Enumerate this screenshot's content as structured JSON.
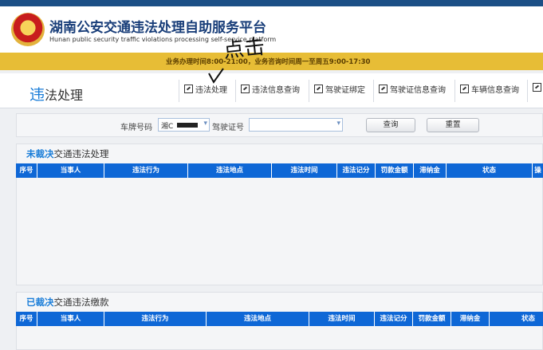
{
  "header": {
    "title_cn": "湖南公安交通违法处理自助服务平台",
    "title_en": "Hunan public security traffic violations processing self-service platform"
  },
  "notice": "业务办理时间8:00-21:00，业务咨询时间周一至周五9:00-17:30",
  "page_title_highlight": "违",
  "page_title_rest": "法处理",
  "nav": [
    {
      "label": "违法处理",
      "icon": "arrow-box-icon"
    },
    {
      "label": "违法信息查询",
      "icon": "arrow-box-icon"
    },
    {
      "label": "驾驶证绑定",
      "icon": "arrow-box-icon"
    },
    {
      "label": "驾驶证信息查询",
      "icon": "arrow-box-icon"
    },
    {
      "label": "车辆信息查询",
      "icon": "arrow-box-icon"
    }
  ],
  "search": {
    "plate_label": "车牌号码",
    "plate_value": "湘C",
    "license_label": "驾驶证号",
    "license_value": "",
    "query_button": "查询",
    "reset_button": "重置"
  },
  "unsettled": {
    "title_highlight": "未裁决",
    "title_rest": "交通违法处理",
    "columns": [
      "序号",
      "当事人",
      "违法行为",
      "违法地点",
      "违法时间",
      "违法记分",
      "罚款金额",
      "滞纳金",
      "状态",
      "操"
    ]
  },
  "settled": {
    "title_highlight": "已裁决",
    "title_rest": "交通违法缴款",
    "columns": [
      "序号",
      "当事人",
      "违法行为",
      "违法地点",
      "违法时间",
      "违法记分",
      "罚款金额",
      "滞纳金",
      "状态"
    ]
  },
  "annotation_text": "点击",
  "colors": {
    "brand_blue": "#1a3f7a",
    "accent_blue": "#0e67d6",
    "notice_yellow": "#e7bd36"
  }
}
